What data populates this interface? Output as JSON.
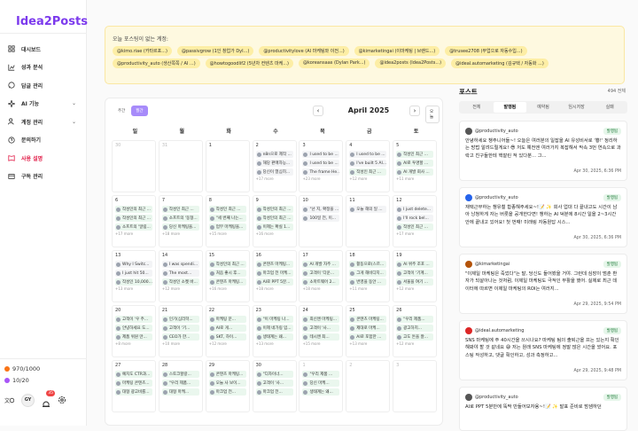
{
  "app": {
    "logo": "Idea2Posts"
  },
  "sidebar": {
    "items": [
      {
        "label": "대시보드",
        "icon": "dashboard-icon"
      },
      {
        "label": "성과 분석",
        "icon": "chart-icon"
      },
      {
        "label": "답글 관리",
        "icon": "reply-icon"
      },
      {
        "label": "AI 기능",
        "icon": "sparkle-icon",
        "chevron": "⌄"
      },
      {
        "label": "계정 관리",
        "icon": "users-icon",
        "chevron": "⌄"
      },
      {
        "label": "문의하기",
        "icon": "help-icon"
      },
      {
        "label": "사용 설명",
        "icon": "book-icon"
      },
      {
        "label": "구독 관리",
        "icon": "card-icon"
      }
    ],
    "credits": "970/1000",
    "accounts": "10/20",
    "avatar": "GY",
    "notifications": "35"
  },
  "notice": {
    "title": "오늘 포스팅이 없는 계정:",
    "accounts": [
      "@kimo.riae (카타르포...)",
      "@passivgrow (1인 창업가 DyI...)",
      "@productivitylove (AI 마케팅와 이전...)",
      "@kimarketingai (이마케팅 | 브랜드...)",
      "@trusee2708 (부업으로 자동수입...)",
      "@productivity_auto (생산쪽쪽 / AI ...)",
      "@howtogoodlif2 (5년차 컨텐츠 마케...)",
      "@koreansaas (Dylan Park...)",
      "@idea2posts (Idea2Posts...)",
      "@ideal.automarketing (김규택 / 자동화 ...)"
    ]
  },
  "calendar": {
    "view_week": "주간",
    "view_month": "월간",
    "month_title": "April 2025",
    "prev": "‹",
    "next": "›",
    "today": "오늘",
    "weekdays": [
      "일",
      "월",
      "화",
      "수",
      "목",
      "금",
      "토"
    ],
    "cells": [
      {
        "day": "30",
        "muted": true,
        "posts": [],
        "more": ""
      },
      {
        "day": "31",
        "muted": true,
        "posts": [],
        "more": ""
      },
      {
        "day": "1",
        "posts": [],
        "more": ""
      },
      {
        "day": "2",
        "posts": [
          {
            "t": "n8n으로 제작 ...",
            "c": "p"
          },
          {
            "t": "해당 판매자능...",
            "c": "p"
          },
          {
            "t": "당신이 열심히...",
            "c": "p"
          }
        ],
        "more": "+17 more"
      },
      {
        "day": "3",
        "posts": [
          {
            "t": "I used to be ...",
            "c": "p"
          },
          {
            "t": "I used to be ...",
            "c": "p"
          },
          {
            "t": "The frame He...",
            "c": "p"
          }
        ],
        "more": "+23 more"
      },
      {
        "day": "4",
        "posts": [
          {
            "t": "I used to be ...",
            "c": "p"
          },
          {
            "t": "I've built 5 AI...",
            "c": "p"
          },
          {
            "t": "작성인 최근 ...",
            "c": "g"
          }
        ],
        "more": "+12 more"
      },
      {
        "day": "5",
        "posts": [
          {
            "t": "작성인 최근 ...",
            "c": "g"
          },
          {
            "t": "AI로 투명할 ...",
            "c": "g"
          },
          {
            "t": "AI 개발 회사 ...",
            "c": "g"
          }
        ],
        "more": "+11 more"
      },
      {
        "day": "6",
        "posts": [
          {
            "t": "작성인의 최근 ...",
            "c": "g"
          },
          {
            "t": "작성인의 최근 ...",
            "c": "g"
          },
          {
            "t": "소프트의 '알림...",
            "c": "g"
          }
        ],
        "more": "+17 more"
      },
      {
        "day": "7",
        "posts": [
          {
            "t": "작성인 최근 ...",
            "c": "g"
          },
          {
            "t": "소프트의 '동형...",
            "c": "g"
          },
          {
            "t": "당신 마케팅을...",
            "c": "g"
          }
        ],
        "more": "+18 more"
      },
      {
        "day": "8",
        "posts": [
          {
            "t": "작성인 최근 ...",
            "c": "g"
          },
          {
            "t": "\"세 번째 나는...",
            "c": "g"
          },
          {
            "t": "업무 마케팅을...",
            "c": "g"
          }
        ],
        "more": "+15 more"
      },
      {
        "day": "9",
        "posts": [
          {
            "t": "작성인의 최근 ...",
            "c": "g"
          },
          {
            "t": "작성인의 최근 ...",
            "c": "g"
          },
          {
            "t": "이제는 확실 1...",
            "c": "g"
          }
        ],
        "more": "+16 more"
      },
      {
        "day": "10",
        "posts": [
          {
            "t": "\"넌 지, 확정을 ...",
            "c": "p"
          },
          {
            "t": "100일 전, 이...",
            "c": "p"
          }
        ],
        "more": ""
      },
      {
        "day": "11",
        "posts": [
          {
            "t": "오늘 해의 일 ...",
            "c": "p"
          }
        ],
        "more": ""
      },
      {
        "day": "12",
        "posts": [
          {
            "t": "I just delete...",
            "c": "p"
          },
          {
            "t": "I'll rock bel...",
            "c": "p"
          },
          {
            "t": "작성인 최근 ...",
            "c": "g"
          }
        ],
        "more": "+17 more"
      },
      {
        "day": "13",
        "posts": [
          {
            "t": "Why I Switc...",
            "c": "p"
          },
          {
            "t": "I just hit 50...",
            "c": "p"
          },
          {
            "t": "작성인 10,000...",
            "c": "g"
          }
        ],
        "more": "+13 more"
      },
      {
        "day": "14",
        "posts": [
          {
            "t": "I was spendi...",
            "c": "p"
          },
          {
            "t": "The most...",
            "c": "p"
          },
          {
            "t": "작성인 소켓 바...",
            "c": "g"
          }
        ],
        "more": "+12 more"
      },
      {
        "day": "15",
        "posts": [
          {
            "t": "작성인의 최근 ...",
            "c": "g"
          },
          {
            "t": "처음 좋시 후...",
            "c": "g"
          },
          {
            "t": "콘텐츠 마케팅...",
            "c": "g"
          }
        ],
        "more": "+16 more"
      },
      {
        "day": "16",
        "posts": [
          {
            "t": "콘텐츠 마케팅...",
            "c": "g"
          },
          {
            "t": "마크업 전 마케...",
            "c": "g"
          },
          {
            "t": "AI로 PPT 5분...",
            "c": "g"
          }
        ],
        "more": "+18 more"
      },
      {
        "day": "17",
        "posts": [
          {
            "t": "AI 개발 자주 ...",
            "c": "g"
          },
          {
            "t": "고객이 '다운...",
            "c": "g"
          },
          {
            "t": "소마트웨어 2...",
            "c": "g"
          }
        ],
        "more": "+18 more"
      },
      {
        "day": "18",
        "posts": [
          {
            "t": "활동으로(스르...",
            "c": "g"
          },
          {
            "t": "그게 해비디지...",
            "c": "g"
          },
          {
            "t": "번영을 동안 ...",
            "c": "g"
          }
        ],
        "more": "+11 more"
      },
      {
        "day": "19",
        "posts": [
          {
            "t": "AI 위주 조포 ...",
            "c": "g"
          },
          {
            "t": "고객이 '기계...",
            "c": "g"
          },
          {
            "t": "서울을 여기 ...",
            "c": "g"
          }
        ],
        "more": "+12 more"
      },
      {
        "day": "20",
        "posts": [
          {
            "t": "고객이 '우 주...",
            "c": "g"
          },
          {
            "t": "안녕하세요 도...",
            "c": "g"
          },
          {
            "t": "제품 위원 만...",
            "c": "g"
          }
        ],
        "more": "+8 more"
      },
      {
        "day": "21",
        "posts": [
          {
            "t": "인기(심리학...",
            "c": "g"
          },
          {
            "t": "고객이 '기...",
            "c": "g"
          },
          {
            "t": "CEO가 한...",
            "c": "g"
          }
        ],
        "more": "+10 more"
      },
      {
        "day": "22",
        "posts": [
          {
            "t": "마케팅 문...",
            "c": "g"
          },
          {
            "t": "AI로 게...",
            "c": "g"
          },
          {
            "t": "SKT, 하이...",
            "c": "g"
          }
        ],
        "more": "+12 more"
      },
      {
        "day": "23",
        "posts": [
          {
            "t": "\"이 마케팅 나...",
            "c": "g"
          },
          {
            "t": "이제 네가링 입...",
            "c": "g"
          },
          {
            "t": "생태계는 왜...",
            "c": "g"
          }
        ],
        "more": "+13 more"
      },
      {
        "day": "24",
        "posts": [
          {
            "t": "최신앤 마케팅...",
            "c": "g"
          },
          {
            "t": "고객이 '사...",
            "c": "g"
          },
          {
            "t": "테시앤 최...",
            "c": "g"
          }
        ],
        "more": "+15 more"
      },
      {
        "day": "25",
        "posts": [
          {
            "t": "콘텐츠 마케팅...",
            "c": "g"
          },
          {
            "t": "제대로 마케...",
            "c": "g"
          },
          {
            "t": "AI로 포함한 ...",
            "c": "g"
          }
        ],
        "more": "+13 more"
      },
      {
        "day": "26",
        "posts": [
          {
            "t": "\"우리 제품...",
            "c": "g"
          },
          {
            "t": "광고하지...",
            "c": "g"
          },
          {
            "t": "고도 돈을 잘...",
            "c": "g"
          }
        ],
        "more": "+12 more"
      },
      {
        "day": "27",
        "posts": [
          {
            "t": "예치도 CTR과...",
            "c": "g"
          },
          {
            "t": "마케팅 콘텐츠...",
            "c": "g"
          },
          {
            "t": "대형 광고비를...",
            "c": "g"
          }
        ],
        "more": ""
      },
      {
        "day": "28",
        "posts": [
          {
            "t": "스토크할랑...",
            "c": "g"
          },
          {
            "t": "\"우리 제품...",
            "c": "g"
          },
          {
            "t": "대형 마케...",
            "c": "g"
          }
        ],
        "more": ""
      },
      {
        "day": "29",
        "posts": [
          {
            "t": "콘텐츠 마케팅...",
            "c": "g"
          },
          {
            "t": "오늘 사 보이...",
            "c": "g"
          },
          {
            "t": "마크업 전...",
            "c": "g"
          }
        ],
        "more": ""
      },
      {
        "day": "30",
        "posts": [
          {
            "t": "\"디자이너...",
            "c": "g"
          },
          {
            "t": "고객이 '사...",
            "c": "g"
          },
          {
            "t": "마크업 전...",
            "c": "g"
          }
        ],
        "more": ""
      },
      {
        "day": "1",
        "muted": true,
        "posts": [
          {
            "t": "\"우리 제품 ...",
            "c": "g"
          },
          {
            "t": "당신 마케...",
            "c": "g"
          },
          {
            "t": "생태계는 왜...",
            "c": "g"
          }
        ],
        "more": ""
      },
      {
        "day": "2",
        "muted": true,
        "posts": [],
        "more": ""
      },
      {
        "day": "3",
        "muted": true,
        "posts": [],
        "more": ""
      }
    ]
  },
  "posts": {
    "title": "포스트",
    "count": "494 전체",
    "tabs": [
      "전체",
      "발행됨",
      "예약됨",
      "임시저장",
      "실패"
    ],
    "cards": [
      {
        "handle": "@productivity_auto",
        "status": "발행됨",
        "body": "안녕하세요 챙주니어들~! 오늘은 여러분의 일잡을 AI 유성비서로 '뿅!' 정리하는 방법 알려드릴게요! 😎 저도 예전엔 여러가지 복잡해서 막속 3번 연속으로 과락고 친구들한테 핵잘린 적 있다분... 그...",
        "date": "Apr 30, 2025, 6:36 PM"
      },
      {
        "handle": "@productivity_auto",
        "status": "발행됨",
        "body": "재택근무하는 챙유철 합종해주세요~!📝 ✨ 회사 업대 다 끝내고도 시간이 남아 낭청하게 자는 버릇을 공개한다면! 챙하는 AI 덕분에 8시간 일을 2~3시간 안에 끝내고 있어요! 첫 번째! 미래링 자동원답 시스...",
        "date": "Apr 30, 2025, 6:36 PM"
      },
      {
        "handle": "@kimarketingai",
        "status": "발행됨",
        "body": "\"이제일 마케팅은 죽었다\"는 말, 당신도 들어봤을 거야. 그런데 심장이 멈춘 환자가 되살아나는 것처럼, 이제일 마케팅도 극적인 부활을 했어. 실제로 최근 데이터에 따르면 이제일 마케팅의 ROI는 여러지...",
        "date": "Apr 29, 2025, 9:54 PM"
      },
      {
        "handle": "@ideal.automarketing",
        "status": "발행됨",
        "body": "SNS 마케팅에 주 40시간을 쓰시나요? 마케팅 팀의 출퇴근을 프는 있는지 확인해봐야 할 것 같네요 😅 저는 원래 SNS 마케팅에 정말 많은 시간을 썼어요. 포스팅 작성하고, 댓글 확인하고, 성과 측정하고...",
        "date": "Apr 29, 2025, 9:48 PM"
      },
      {
        "handle": "@productivity_auto",
        "status": "발행됨",
        "body": "AI로 PPT 5분만에 뚝딱 만들어보자용~!📝 ✨ 발표 준비로 밤샘하던",
        "date": ""
      }
    ]
  }
}
